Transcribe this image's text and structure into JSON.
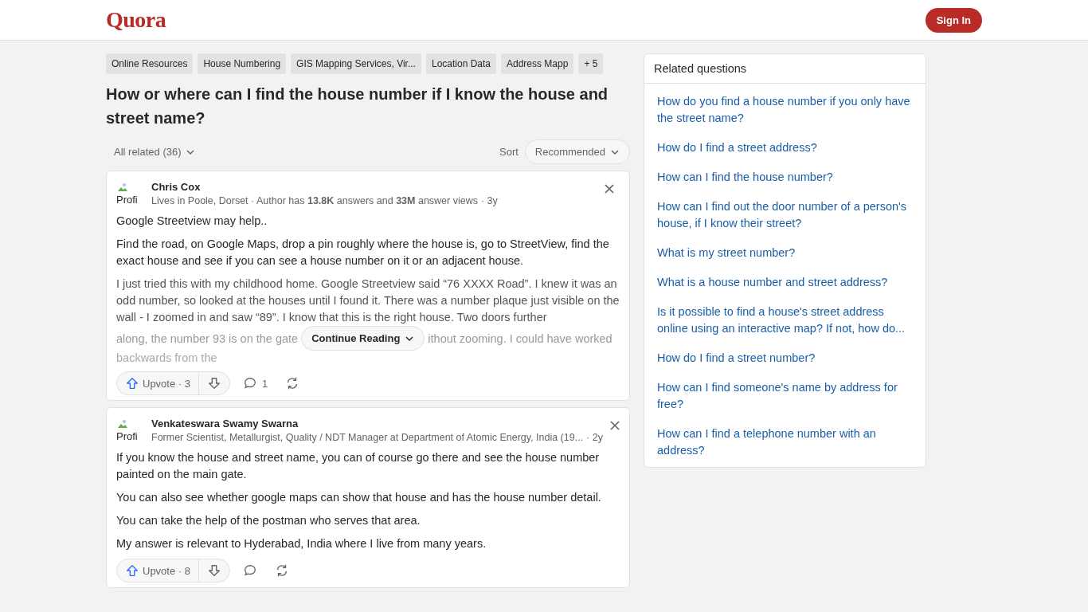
{
  "header": {
    "logo": "Quora",
    "sign_in": "Sign In"
  },
  "topics": [
    {
      "label": "Online Resources"
    },
    {
      "label": "House Numbering"
    },
    {
      "label": "GIS Mapping Services, Vir..."
    },
    {
      "label": "Location Data"
    },
    {
      "label": "Address Mapp"
    },
    {
      "label": "+ 5"
    }
  ],
  "question": "How or where can I find the house number if I know the house and street name?",
  "filter": {
    "label": "All related (36)",
    "sort_label": "Sort",
    "sort_value": "Recommended"
  },
  "answers": [
    {
      "author": "Chris Cox",
      "avatar_alt": "Profi",
      "meta": "Lives in Poole, Dorset · Author has **13.8K** answers and **33M** answer views",
      "time": "· 3y",
      "paragraphs": [
        "Google Streetview may help..",
        "Find the road, on Google Maps, drop a pin roughly where the house is, go to StreetView, find the exact house and see if you can see a house number on it or an adjacent house."
      ],
      "truncated": {
        "text": "I just tried this with my childhood home. Google Streetview said “76 XXXX Road”. I knew it was an odd number, so looked at the houses until I found it. There was a number plaque just visible on the wall - I zoomed in and saw “89”. I know that this is the right house. Two doors further",
        "before_button": "along, the number 93 is on the gate",
        "button": "Continue Reading",
        "after_button": "ithout zooming. I could have worked",
        "last": "backwards from the"
      },
      "upvote": "Upvote · 3",
      "comments": "1"
    },
    {
      "author": "Venkateswara Swamy Swarna",
      "avatar_alt": "Profi",
      "meta": "Former Scientist, Metallurgist, Quality / NDT Manager at Department of Atomic Energy, India (19...",
      "time": "· 2y",
      "paragraphs": [
        "If you know the house and street name, you can of course go there and see the house number painted on the main gate.",
        "You can also see whether google maps can show that house and has the house number detail.",
        "You can take the help of the postman who serves that area.",
        "My answer is relevant to Hyderabad, India where I live from many years."
      ],
      "upvote": "Upvote · 8"
    }
  ],
  "related": {
    "title": "Related questions",
    "items": [
      "How do you find a house number if you only have the street name?",
      "How do I find a street address?",
      "How can I find the house number?",
      "How can I find out the door number of a person's house, if I know their street?",
      "What is my street number?",
      "What is a house number and street address?",
      "Is it possible to find a house's street address online using an interactive map? If not, how do...",
      "How do I find a street number?",
      "How can I find someone's name by address for free?",
      "How can I find a telephone number with an address?"
    ]
  }
}
